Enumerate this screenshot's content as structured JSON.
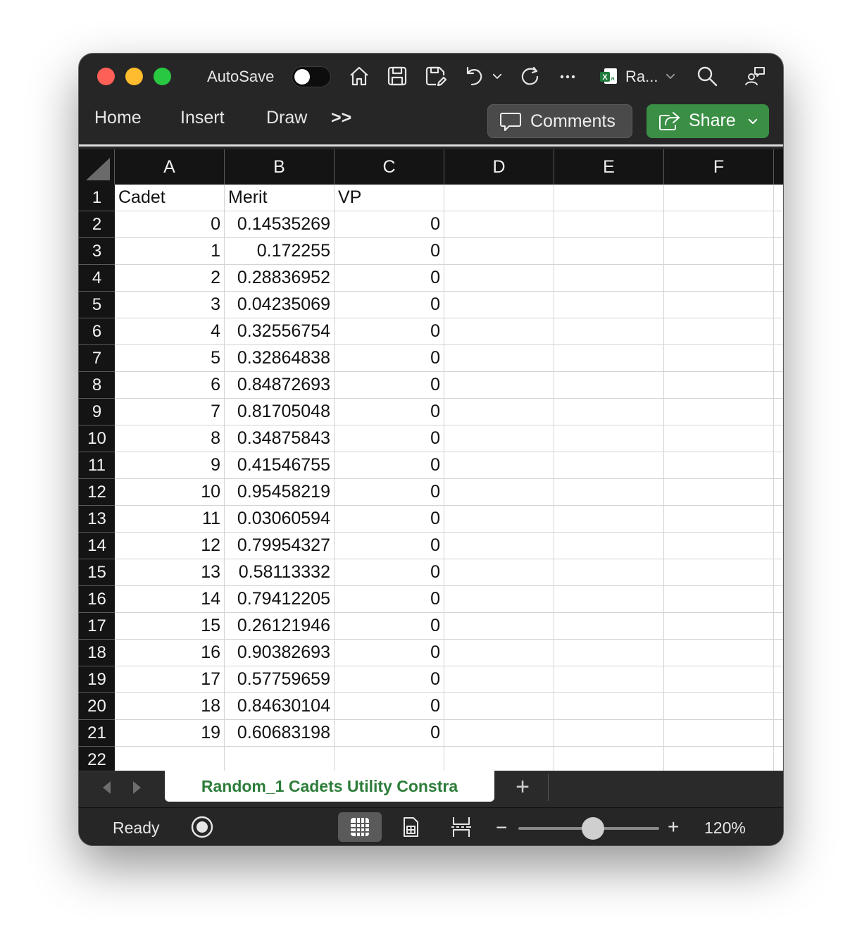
{
  "titlebar": {
    "autosave_label": "AutoSave",
    "autosave_on": false,
    "file_name": "Ra...",
    "icons": [
      "home-icon",
      "save-icon",
      "save-as-icon",
      "undo-icon",
      "undo-dropdown-icon",
      "redo-icon",
      "more-icon",
      "excel-file-icon",
      "file-dropdown-icon",
      "search-icon",
      "share-people-icon"
    ]
  },
  "ribbon": {
    "tabs": [
      "Home",
      "Insert",
      "Draw"
    ],
    "overflow_label": ">>",
    "comments_label": "Comments",
    "share_label": "Share"
  },
  "sheet": {
    "columns": [
      "A",
      "B",
      "C",
      "D",
      "E",
      "F"
    ],
    "row_numbers": [
      "1",
      "2",
      "3",
      "4",
      "5",
      "6",
      "7",
      "8",
      "9",
      "10",
      "11",
      "12",
      "13",
      "14",
      "15",
      "16",
      "17",
      "18",
      "19",
      "20",
      "21",
      "22"
    ],
    "headers": [
      "Cadet",
      "Merit",
      "VP"
    ],
    "rows": [
      [
        "0",
        "0.14535269",
        "0"
      ],
      [
        "1",
        "0.172255",
        "0"
      ],
      [
        "2",
        "0.28836952",
        "0"
      ],
      [
        "3",
        "0.04235069",
        "0"
      ],
      [
        "4",
        "0.32556754",
        "0"
      ],
      [
        "5",
        "0.32864838",
        "0"
      ],
      [
        "6",
        "0.84872693",
        "0"
      ],
      [
        "7",
        "0.81705048",
        "0"
      ],
      [
        "8",
        "0.34875843",
        "0"
      ],
      [
        "9",
        "0.41546755",
        "0"
      ],
      [
        "10",
        "0.95458219",
        "0"
      ],
      [
        "11",
        "0.03060594",
        "0"
      ],
      [
        "12",
        "0.79954327",
        "0"
      ],
      [
        "13",
        "0.58113332",
        "0"
      ],
      [
        "14",
        "0.79412205",
        "0"
      ],
      [
        "15",
        "0.26121946",
        "0"
      ],
      [
        "16",
        "0.90382693",
        "0"
      ],
      [
        "17",
        "0.57759659",
        "0"
      ],
      [
        "18",
        "0.84630104",
        "0"
      ],
      [
        "19",
        "0.60683198",
        "0"
      ]
    ]
  },
  "tabs_bar": {
    "active_sheet": "Random_1 Cadets Utility Constra",
    "add_label": "+"
  },
  "status": {
    "ready_label": "Ready",
    "zoom_minus": "−",
    "zoom_plus": "+",
    "zoom_label": "120%",
    "zoom_percent": 120
  },
  "colors": {
    "window_bg": "#262626",
    "share_green": "#3a8f45",
    "sheet_tab_text": "#2d7d3a",
    "header_bg": "#141414"
  }
}
